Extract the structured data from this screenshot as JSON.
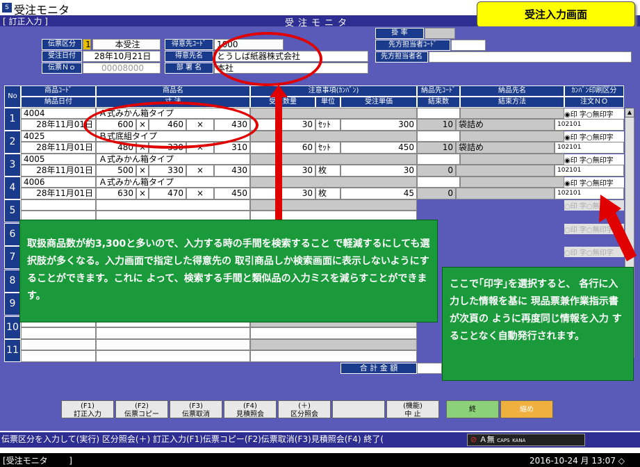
{
  "window": {
    "title": "受注モニタ",
    "mode": "[ 訂正入力 ]",
    "screen_title": "受注モニタ"
  },
  "callout_top": "受注入力画面",
  "header": {
    "denpyo_kubun_label": "伝票区分",
    "denpyo_kubun_code": "1",
    "denpyo_kubun_value": "本受注",
    "juchu_date_label": "受注日付",
    "juchu_date_value": "28年10月21日",
    "denpyo_no_label": "伝票Ｎｏ",
    "denpyo_no_value": "00008000",
    "tokuisaki_code_label": "得意先ｺｰﾄﾞ",
    "tokuisaki_code_value": "1000",
    "tokuisaki_name_label": "得意先名",
    "tokuisaki_name_value": "とうしば紙器株式会社",
    "busho_label": "部 署 名",
    "busho_value": "本社",
    "kakeritsu_label": "掛 率",
    "senpo_code_label": "先方担当者ｺｰﾄﾞ",
    "senpo_name_label": "先方担当者名"
  },
  "table_headers": {
    "no": "No",
    "item_code": "商品ｺｰﾄﾞ",
    "item_name": "商品名",
    "delivery_date": "納品日付",
    "size": "寸 法",
    "notes": "注意事項(ｶﾝﾊﾞﾝ)",
    "order_qty": "受注数量",
    "unit": "単位",
    "unit_price": "受注単価",
    "deliv_code": "納品先ｺｰﾄﾞ",
    "deliv_name": "納品先名",
    "bundle_qty": "結束数",
    "bundle_method": "結束方法",
    "kanban_print": "ｶﾝﾊﾞﾝ印刷区分",
    "order_no": "注文ＮＯ"
  },
  "rows": [
    {
      "no": "1",
      "code": "4004",
      "name": "Ａ式みかん箱タイプ",
      "date": "28年11月01日",
      "d1": "600",
      "d2": "460",
      "d3": "430",
      "qty": "30",
      "unit": "ｾｯﾄ",
      "price": "300",
      "bundle": "10",
      "method": "袋詰め",
      "order_no": "102101"
    },
    {
      "no": "2",
      "code": "4025",
      "name": "Ｂ式底組タイプ",
      "date": "28年11月01日",
      "d1": "480",
      "d2": "330",
      "d3": "310",
      "qty": "60",
      "unit": "ｾｯﾄ",
      "price": "450",
      "bundle": "10",
      "method": "袋詰め",
      "order_no": "102101"
    },
    {
      "no": "3",
      "code": "4005",
      "name": "Ａ式みかん箱タイプ",
      "date": "28年11月01日",
      "d1": "500",
      "d2": "330",
      "d3": "430",
      "qty": "30",
      "unit": "枚",
      "price": "30",
      "bundle": "0",
      "method": "",
      "order_no": "102101"
    },
    {
      "no": "4",
      "code": "4006",
      "name": "Ａ式みかん箱タイプ",
      "date": "28年11月01日",
      "d1": "630",
      "d2": "470",
      "d3": "450",
      "qty": "30",
      "unit": "枚",
      "price": "45",
      "bundle": "0",
      "method": "",
      "order_no": "102101"
    }
  ],
  "empty_row_numbers": [
    "5",
    "6",
    "7",
    "8",
    "9",
    "10",
    "11"
  ],
  "times": "×",
  "radio": {
    "print": "印 字",
    "noprint": "無印字"
  },
  "total_label": "合 計 金 額",
  "callout_left": "取扱商品数が約3,300と多いので、入力する時の手間を検索すること で軽減するにしても選択肢が多くなる。入力画面で指定した得意先の 取引商品しか検索画面に表示しないようにすることができます。これに よって、検索する手間と類似品の入力ミスを減らすことができます。",
  "callout_right": "ここで｢印字｣を選択すると、 各行に入力した情報を基に 現品票兼作業指示書が次頁の ように再度同じ情報を入力 することなく自動発行されます。",
  "fkeys": [
    {
      "top": "(F1)",
      "bottom": "訂正入力"
    },
    {
      "top": "(F2)",
      "bottom": "伝票コピー"
    },
    {
      "top": "(F3)",
      "bottom": "伝票取消"
    },
    {
      "top": "(F4)",
      "bottom": "見積照会"
    },
    {
      "top": "(＋)",
      "bottom": "区分照会"
    },
    {
      "top": "",
      "bottom": ""
    },
    {
      "top": "(機能)",
      "bottom": "中 止"
    }
  ],
  "btn_end": "終",
  "btn_reset": "縮め",
  "status_text": "伝票区分を入力して(実行) 区分照会(＋) 訂正入力(F1)伝票コピー(F2)伝票取消(F3)見積照会(F4) 終了(",
  "ime": {
    "letter": "Ａ",
    "mode": "無",
    "caps": "CAPS",
    "kana": "KANA"
  },
  "bottom": {
    "left": "[受注モニタ        ]",
    "right": "2016-10-24 月 13:07 ◇"
  }
}
